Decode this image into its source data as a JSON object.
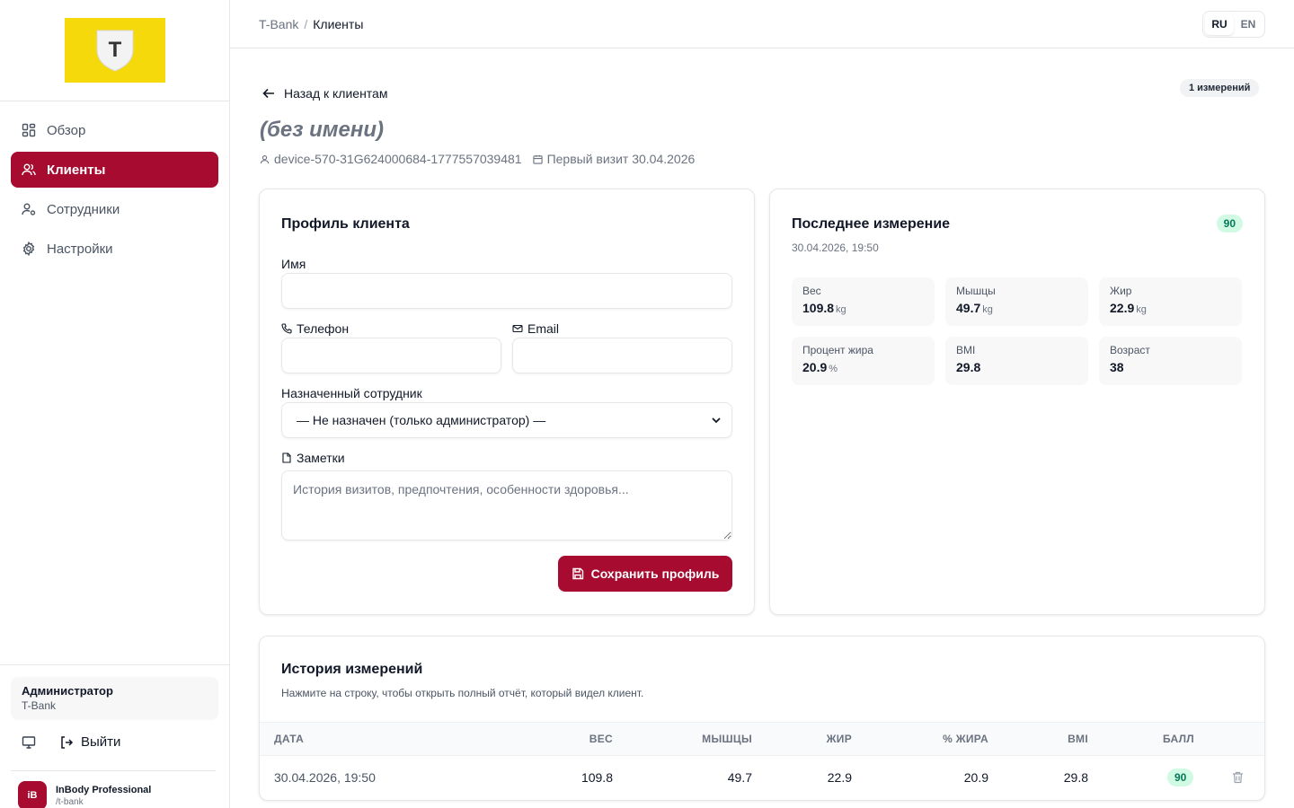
{
  "sidebar": {
    "logo_letter": "T",
    "items": [
      {
        "label": "Обзор",
        "icon": "dashboard-icon",
        "active": false
      },
      {
        "label": "Клиенты",
        "icon": "users-icon",
        "active": true
      },
      {
        "label": "Сотрудники",
        "icon": "staff-icon",
        "active": false
      },
      {
        "label": "Настройки",
        "icon": "gear-icon",
        "active": false
      }
    ],
    "admin_role": "Администратор",
    "admin_org": "T-Bank",
    "logout_label": "Выйти",
    "brand_badge": "iB",
    "brand_name": "InBody Professional",
    "brand_slug": "/t-bank"
  },
  "header": {
    "crumb_root": "T-Bank",
    "crumb_sep": "/",
    "crumb_current": "Клиенты",
    "lang_ru": "RU",
    "lang_en": "EN",
    "active_lang": "RU"
  },
  "client": {
    "back_label": "Назад к клиентам",
    "measurements_count": "1 измерений",
    "name": "(без имени)",
    "device_id": "device-570-31G624000684-1777557039481",
    "first_visit": "Первый визит 30.04.2026"
  },
  "profile": {
    "title": "Профиль клиента",
    "name_label": "Имя",
    "name_value": "",
    "phone_label": "Телефон",
    "phone_value": "",
    "email_label": "Email",
    "email_value": "",
    "staff_label": "Назначенный сотрудник",
    "staff_selected": "— Не назначен (только администратор) —",
    "notes_label": "Заметки",
    "notes_placeholder": "История визитов, предпочтения, особенности здоровья...",
    "save_label": "Сохранить профиль"
  },
  "last_measurement": {
    "title": "Последнее измерение",
    "date": "30.04.2026, 19:50",
    "score": "90",
    "metrics": [
      {
        "label": "Вес",
        "value": "109.8",
        "unit": "kg"
      },
      {
        "label": "Мышцы",
        "value": "49.7",
        "unit": "kg"
      },
      {
        "label": "Жир",
        "value": "22.9",
        "unit": "kg"
      },
      {
        "label": "Процент жира",
        "value": "20.9",
        "unit": "%"
      },
      {
        "label": "BMI",
        "value": "29.8",
        "unit": ""
      },
      {
        "label": "Возраст",
        "value": "38",
        "unit": ""
      }
    ]
  },
  "history": {
    "title": "История измерений",
    "subtitle": "Нажмите на строку, чтобы открыть полный отчёт, который видел клиент.",
    "columns": [
      "ДАТА",
      "ВЕС",
      "МЫШЦЫ",
      "ЖИР",
      "% ЖИРА",
      "BMI",
      "БАЛЛ"
    ],
    "rows": [
      {
        "date": "30.04.2026, 19:50",
        "weight": "109.8",
        "muscle": "49.7",
        "fat": "22.9",
        "fat_pct": "20.9",
        "bmi": "29.8",
        "score": "90"
      }
    ]
  },
  "colors": {
    "accent": "#a70b30",
    "logo_bg": "#f5d90a",
    "score_bg": "#d1fae5",
    "score_fg": "#047857"
  }
}
